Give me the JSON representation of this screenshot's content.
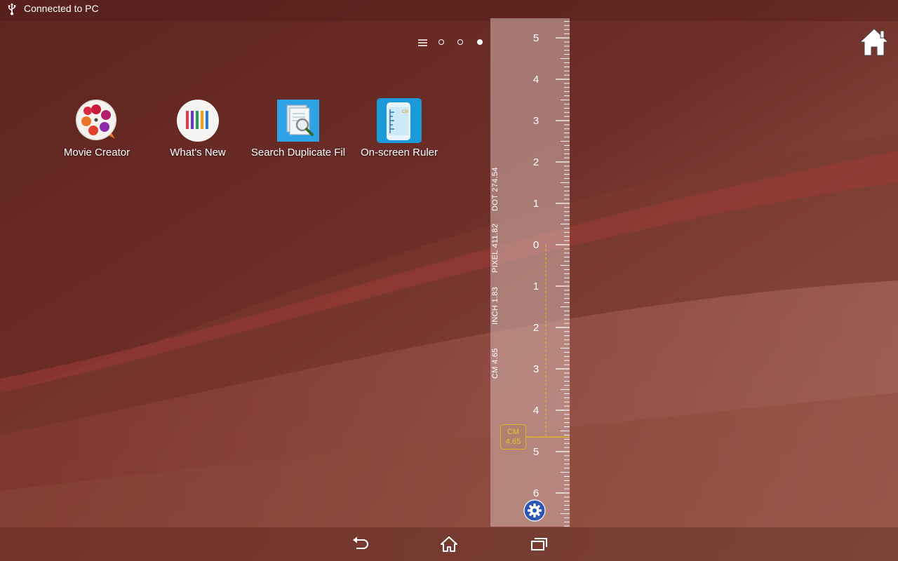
{
  "status_bar": {
    "text": "Connected to PC",
    "icon": "usb-icon"
  },
  "launcher": {
    "page_indicator": {
      "pages": 3,
      "current_page": 3
    },
    "apps": [
      {
        "label": "Movie Creator",
        "icon": "movie-creator-icon"
      },
      {
        "label": "What's New",
        "icon": "whats-new-icon"
      },
      {
        "label": "Search Duplicate Fil",
        "icon": "search-duplicate-files-icon"
      },
      {
        "label": "On-screen Ruler",
        "icon": "on-screen-ruler-icon"
      }
    ]
  },
  "ruler": {
    "upper_ticks": [
      "5",
      "4",
      "3",
      "2",
      "1"
    ],
    "lower_ticks": [
      "0",
      "1",
      "2",
      "3",
      "4",
      "5",
      "6"
    ],
    "measurements": {
      "dot": "DOT 274.54",
      "pixel": "PIXEL 411.82",
      "inch": "INCH 1.83",
      "cm": "CM 4.65"
    },
    "marker": {
      "unit": "CM",
      "value": "4.65"
    },
    "accent_color": "#e0b321"
  },
  "nav_bar": {
    "buttons": [
      "back-icon",
      "home-icon",
      "recents-icon"
    ]
  },
  "colors": {
    "wallpaper_dark": "#5e2420",
    "wallpaper_light": "#a56450",
    "settings_blue": "#2a56b0"
  }
}
